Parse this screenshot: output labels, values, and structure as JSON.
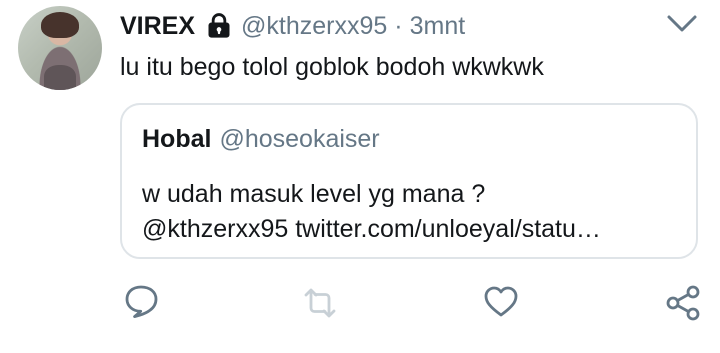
{
  "tweet": {
    "display_name": "VIREX",
    "handle": "@kthzerxx95",
    "separator": "·",
    "time": "3mnt",
    "text": "lu itu bego tolol goblok bodoh wkwkwk",
    "protected_icon": "lock-icon",
    "menu_icon": "chevron-down-icon"
  },
  "quoted": {
    "display_name": "Hobal",
    "handle": "@hoseokaiser",
    "line1": "w udah masuk level yg mana ?",
    "line2": "@kthzerxx95 twitter.com/unloeyal/statu…"
  },
  "actions": [
    {
      "name": "reply",
      "icon": "reply-icon"
    },
    {
      "name": "retweet",
      "icon": "retweet-icon"
    },
    {
      "name": "like",
      "icon": "heart-icon"
    },
    {
      "name": "share",
      "icon": "share-icon"
    }
  ],
  "colors": {
    "text": "#14171a",
    "secondary": "#657786",
    "border": "#dfe4e8",
    "icon": "#657786"
  }
}
